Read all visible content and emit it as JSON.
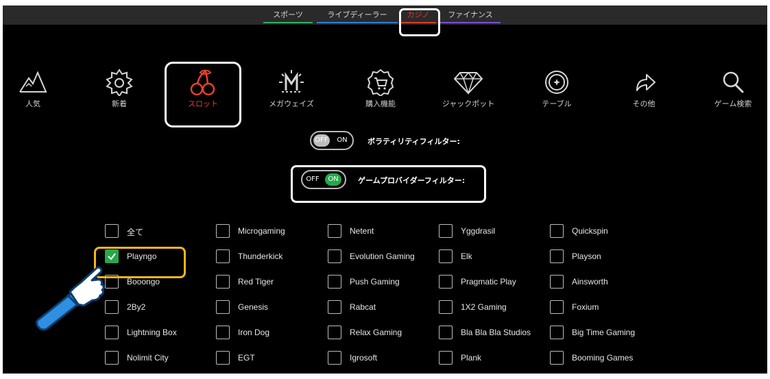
{
  "top_tabs": [
    {
      "label": "スポーツ",
      "color": "#2fb35a",
      "active": false
    },
    {
      "label": "ライブディーラー",
      "color": "#2b7fd6",
      "active": false
    },
    {
      "label": "カジノ",
      "color": "#e03b2c",
      "active": true
    },
    {
      "label": "ファイナンス",
      "color": "#7a4fd1",
      "active": false
    }
  ],
  "categories": [
    {
      "label": "人気",
      "icon": "mountain-icon"
    },
    {
      "label": "新着",
      "icon": "sun-badge-icon"
    },
    {
      "label": "スロット",
      "icon": "cherry-icon",
      "active": true
    },
    {
      "label": "メガウェイズ",
      "icon": "megaways-icon"
    },
    {
      "label": "購入機能",
      "icon": "cart-badge-icon"
    },
    {
      "label": "ジャックポット",
      "icon": "diamond-icon"
    },
    {
      "label": "テーブル",
      "icon": "chip-icon"
    },
    {
      "label": "その他",
      "icon": "share-arrow-icon"
    },
    {
      "label": "ゲーム検索",
      "icon": "search-icon"
    }
  ],
  "filters": {
    "volatility": {
      "label": "ボラティリティフィルター:",
      "off": "OFF",
      "on": "ON",
      "state": "off"
    },
    "provider": {
      "label": "ゲームプロバイダーフィルター:",
      "off": "OFF",
      "on": "ON",
      "state": "on"
    }
  },
  "providers": [
    [
      "全て",
      "Microgaming",
      "Netent",
      "Yggdrasil",
      "Quickspin"
    ],
    [
      "Playngo",
      "Thunderkick",
      "Evolution Gaming",
      "Elk",
      "Playson"
    ],
    [
      "Booongo",
      "Red Tiger",
      "Push Gaming",
      "Pragmatic Play",
      "Ainsworth"
    ],
    [
      "2By2",
      "Genesis",
      "Rabcat",
      "1X2 Gaming",
      "Foxium"
    ],
    [
      "Lightning Box",
      "Iron Dog",
      "Relax Gaming",
      "Bla Bla Bla Studios",
      "Big Time Gaming"
    ],
    [
      "Nolimit City",
      "EGT",
      "Igrosoft",
      "Plank",
      "Booming Games"
    ]
  ],
  "checked": [
    "Playngo"
  ]
}
